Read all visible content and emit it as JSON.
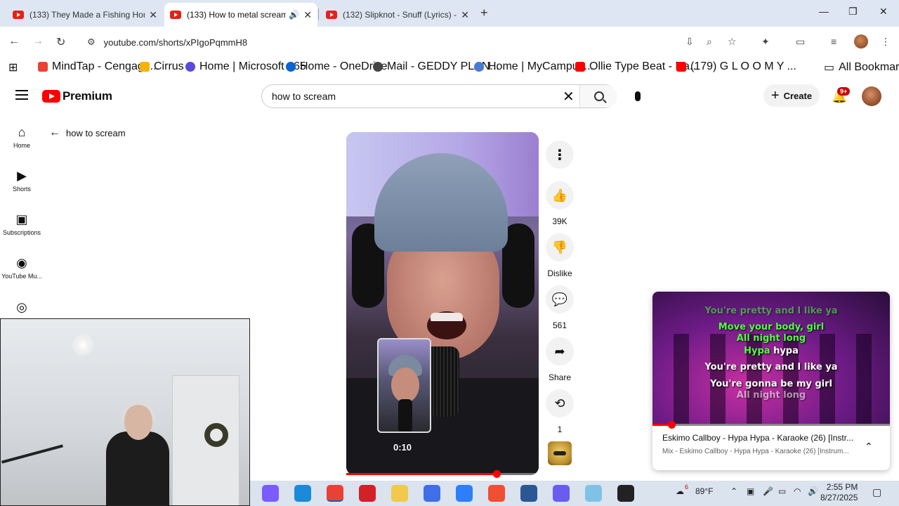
{
  "browser": {
    "tabs": [
      {
        "title": "(133) They Made a Fishing Hori",
        "active": false
      },
      {
        "title": "(133) How to metal scream",
        "active": true
      },
      {
        "title": "(132) Slipknot - Snuff (Lyrics) - \\",
        "active": false
      }
    ],
    "new_tab": "+",
    "window_controls": {
      "minimize": "—",
      "restore": "❐",
      "close": "✕"
    },
    "url": "youtube.com/shorts/xPIgoPqmmH8",
    "bookmarks": [
      {
        "label": "MindTap - Cengage...",
        "color": "#e94235"
      },
      {
        "label": "Cirrus",
        "color": "#f4b400"
      },
      {
        "label": "Home | Microsoft 365",
        "color": "#5b4bdb"
      },
      {
        "label": "Home - OneDrive",
        "color": "#0a64d4"
      },
      {
        "label": "Mail - GEDDY PLAN...",
        "color": "#444444"
      },
      {
        "label": "Home | MyCampus...",
        "color": "#4a7bd4"
      },
      {
        "label": "Ollie Type Beat - Da...",
        "color": "#ff0000"
      },
      {
        "label": "(179) G L O O M Y ...",
        "color": "#ff0000"
      }
    ],
    "all_bookmarks": "All Bookmarks"
  },
  "youtube": {
    "brand": "Premium",
    "search": {
      "value": "how to scream"
    },
    "create_label": "Create",
    "notification_count": "9+",
    "sidebar": [
      {
        "label": "Home",
        "icon": "⌂"
      },
      {
        "label": "Shorts",
        "icon": "▶"
      },
      {
        "label": "Subscriptions",
        "icon": "▣"
      },
      {
        "label": "YouTube Mu...",
        "icon": "◉"
      },
      {
        "label": "",
        "icon": "◎"
      }
    ],
    "back_label": "how to scream",
    "short": {
      "preview_time": "0:10",
      "progress": 0.78
    },
    "actions": {
      "like_count": "39K",
      "dislike_label": "Dislike",
      "comment_count": "561",
      "share_label": "Share",
      "remix_count": "1"
    }
  },
  "miniplayer": {
    "lyrics": [
      {
        "text": "You're pretty and I like ya",
        "style": "g dim"
      },
      {
        "text": "Move your body, girl",
        "style": "g"
      },
      {
        "text": "All night long",
        "style": "g"
      },
      {
        "text": "Hypa hypa",
        "style": "mixed"
      },
      {
        "text": "You're pretty and I like ya",
        "style": "w"
      },
      {
        "text": "You're gonna be my girl",
        "style": "w"
      },
      {
        "text": "All night long",
        "style": "w dim"
      }
    ],
    "progress": 0.08,
    "title": "Eskimo Callboy - Hypa Hypa - Karaoke (26) [Instr...",
    "subtitle": "Mix - Eskimo Callboy - Hypa Hypa - Karaoke (26) [Instrum..."
  },
  "taskbar": {
    "apps": [
      {
        "name": "copilot",
        "color": "#7b5cff"
      },
      {
        "name": "edge",
        "color": "#1b8ad8"
      },
      {
        "name": "chrome",
        "color": "#e94235",
        "active": true
      },
      {
        "name": "opera",
        "color": "#d42027"
      },
      {
        "name": "file-explorer",
        "color": "#f2c94c"
      },
      {
        "name": "m365",
        "color": "#3f6fe6"
      },
      {
        "name": "store",
        "color": "#2d7ff9"
      },
      {
        "name": "git",
        "color": "#f14e32"
      },
      {
        "name": "word",
        "color": "#2b5797"
      },
      {
        "name": "discord",
        "color": "#6b5cf0"
      },
      {
        "name": "notepad",
        "color": "#7ec3e6"
      },
      {
        "name": "obs",
        "color": "#222222"
      }
    ],
    "weather_badge": "6",
    "temperature": "89°F",
    "time": "2:55 PM",
    "date": "8/27/2025"
  }
}
